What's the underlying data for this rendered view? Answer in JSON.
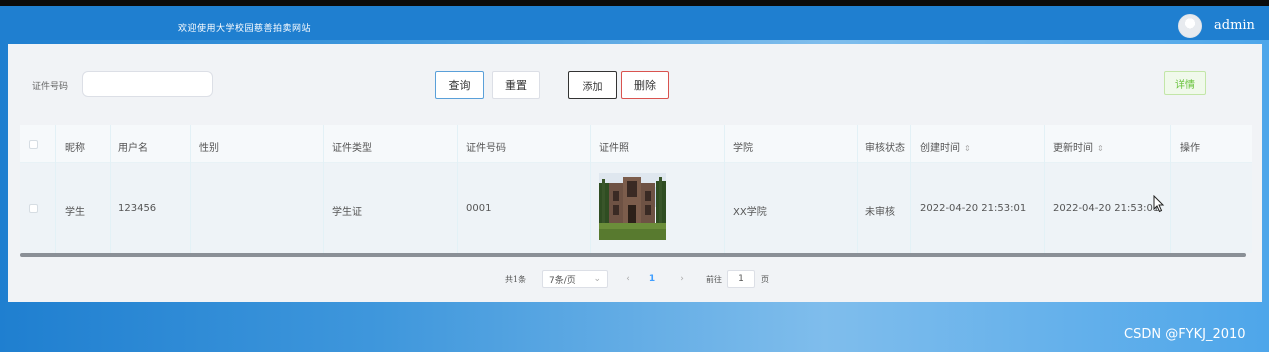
{
  "header": {
    "site_title": "欢迎使用大学校园慈善拍卖网站",
    "username": "admin"
  },
  "search": {
    "label": "证件号码",
    "value": "",
    "placeholder": ""
  },
  "actions": {
    "query": "查询",
    "reset": "重置",
    "add": "添加",
    "delete": "删除"
  },
  "table": {
    "columns": [
      "昵称",
      "用户名",
      "性别",
      "证件类型",
      "证件号码",
      "证件照",
      "学院",
      "审核状态",
      "创建时间",
      "更新时间",
      "操作"
    ],
    "sort_icon": "⇕",
    "rows": [
      {
        "nickname": "学生",
        "username": "123456",
        "gender": "",
        "id_type": "学生证",
        "id_number": "0001",
        "college": "XX学院",
        "status": "未审核",
        "created": "2022-04-20 21:53:01",
        "updated": "2022-04-20 21:53:01",
        "detail": "详情"
      }
    ]
  },
  "pagination": {
    "total": "共1条",
    "page_size": "7条/页",
    "current_page": "1",
    "goto_label": "前往",
    "goto_value": "1",
    "page_unit": "页"
  },
  "watermark": "CSDN @FYKJ_2010",
  "colors": {
    "header_bg": "#1f7fd0",
    "accent": "#409eff",
    "detail_green": "#67c23a",
    "delete_red": "#d9534f"
  }
}
